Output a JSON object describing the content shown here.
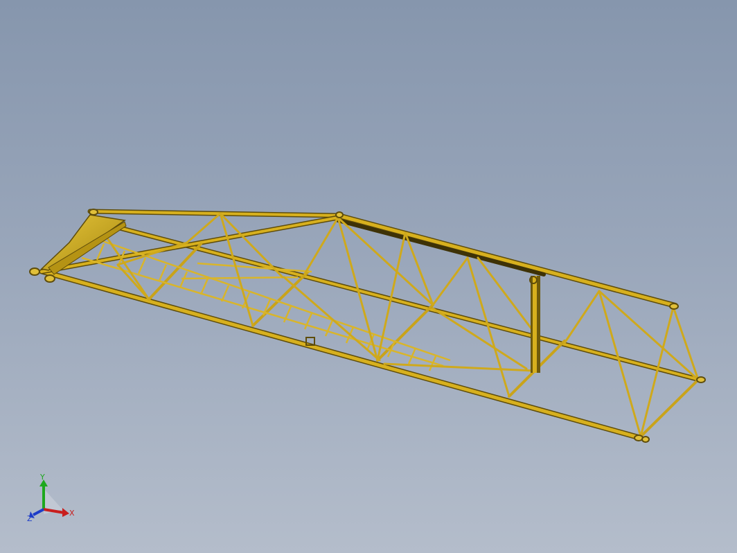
{
  "view": {
    "background_top": "#8696ad",
    "background_bottom": "#b4bdcb"
  },
  "model": {
    "name": "truss-boom-section",
    "color": "#d7b01e",
    "dark_color": "#6e5a0c"
  },
  "triad": {
    "x_label": "X",
    "y_label": "Y",
    "z_label": "Z",
    "x_color": "#c81e1e",
    "y_color": "#1ea81e",
    "z_color": "#1e3cc8"
  }
}
